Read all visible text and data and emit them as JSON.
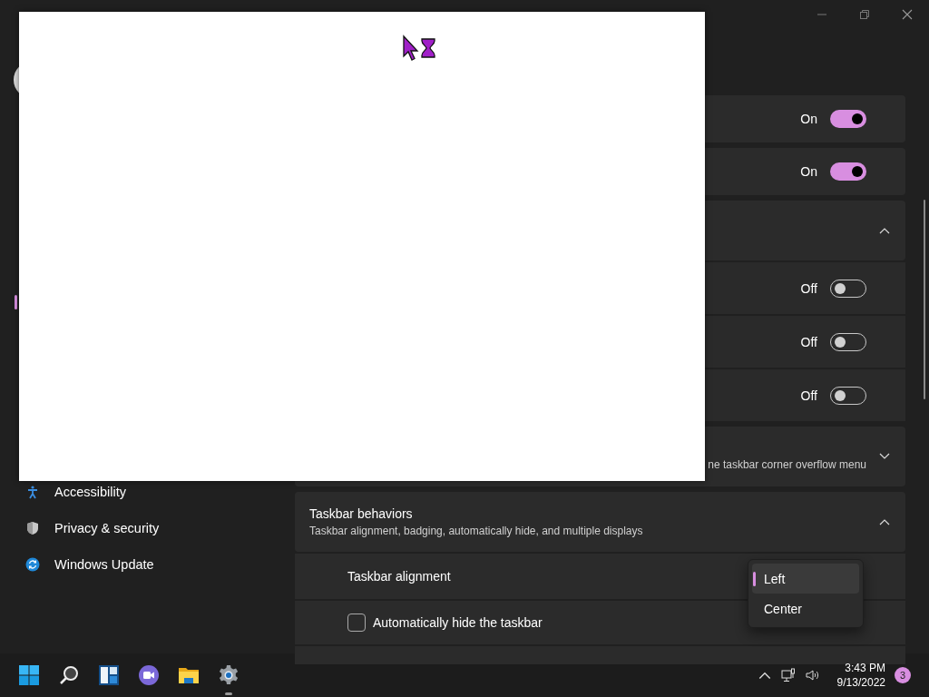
{
  "sidebar": {
    "items": [
      {
        "label": "Accessibility",
        "kind": "accessibility"
      },
      {
        "label": "Privacy & security",
        "kind": "privacy"
      },
      {
        "label": "Windows Update",
        "kind": "update"
      }
    ]
  },
  "settings_rows": [
    {
      "kind": "toggle",
      "state": "On",
      "on": true
    },
    {
      "kind": "toggle",
      "state": "On",
      "on": true
    },
    {
      "kind": "expander",
      "expanded": true
    },
    {
      "kind": "subtoggle",
      "state": "Off",
      "on": false
    },
    {
      "kind": "subtoggle",
      "state": "Off",
      "on": false
    },
    {
      "kind": "subtoggle",
      "state": "Off",
      "on": false
    },
    {
      "kind": "expander",
      "expanded": false,
      "description": "ne taskbar corner overflow menu"
    },
    {
      "kind": "expander",
      "expanded": true,
      "title": "Taskbar behaviors",
      "description": "Taskbar alignment, badging, automatically hide, and multiple displays"
    },
    {
      "kind": "dropdown",
      "label": "Taskbar alignment",
      "options": [
        {
          "label": "Left",
          "selected": true
        },
        {
          "label": "Center",
          "selected": false
        }
      ]
    },
    {
      "kind": "checkbox",
      "label": "Automatically hide the taskbar",
      "checked": false
    }
  ],
  "taskbar": {
    "apps": [
      {
        "kind": "start",
        "running": false
      },
      {
        "kind": "search",
        "running": false
      },
      {
        "kind": "widgets",
        "running": false
      },
      {
        "kind": "chat",
        "running": false
      },
      {
        "kind": "explorer",
        "running": false
      },
      {
        "kind": "settings",
        "running": true
      }
    ],
    "time": "3:43 PM",
    "date": "9/13/2022",
    "notification_count": "3"
  }
}
